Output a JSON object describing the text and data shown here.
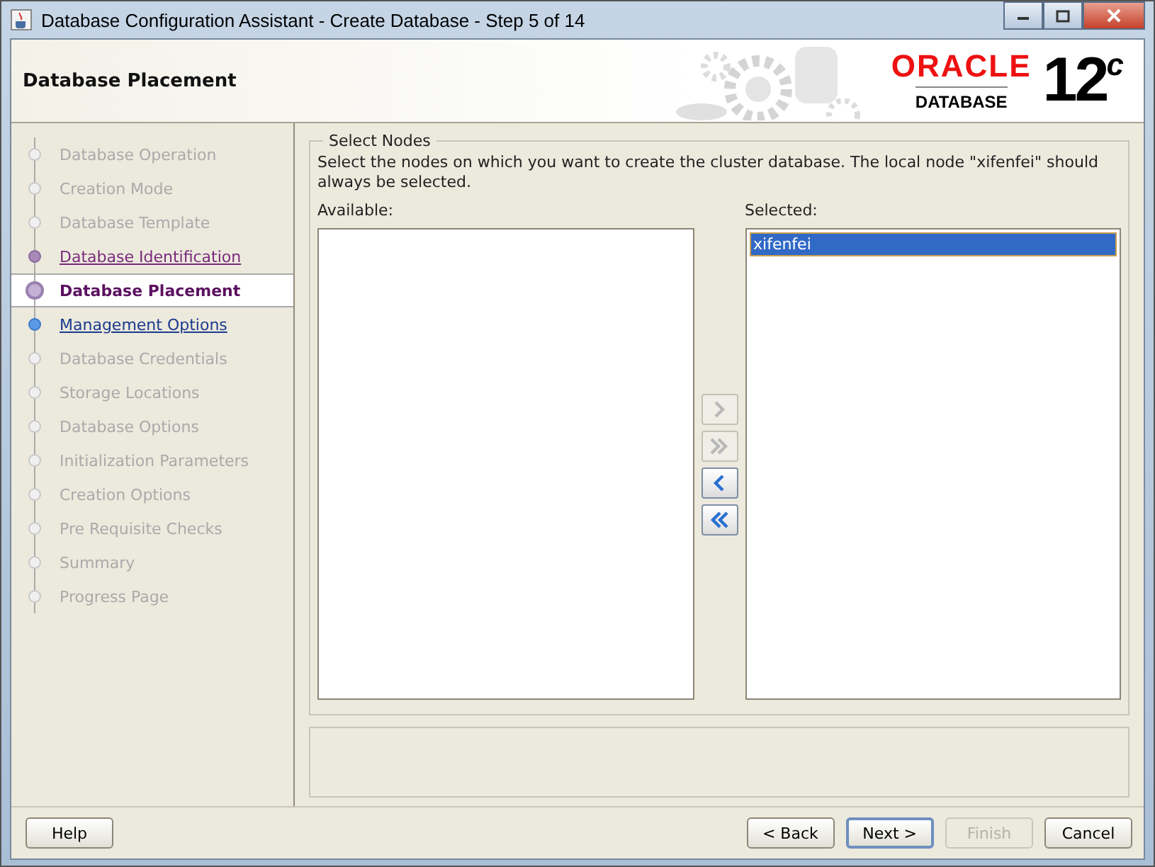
{
  "window": {
    "title": "Database Configuration Assistant - Create Database - Step 5 of 14"
  },
  "header": {
    "title": "Database Placement",
    "logo_brand": "ORACLE",
    "logo_product": "DATABASE",
    "logo_version": "12",
    "logo_suffix": "c"
  },
  "steps": [
    {
      "label": "Database Operation",
      "selected": false,
      "completed": false,
      "disabled": true
    },
    {
      "label": "Creation Mode",
      "selected": false,
      "completed": false,
      "disabled": true
    },
    {
      "label": "Database Template",
      "selected": false,
      "completed": false,
      "disabled": true
    },
    {
      "label": "Database Identification",
      "selected": false,
      "completed": true,
      "disabled": false
    },
    {
      "label": "Database Placement",
      "selected": true,
      "completed": false,
      "disabled": false
    },
    {
      "label": "Management Options",
      "selected": false,
      "completed": false,
      "disabled": false
    },
    {
      "label": "Database Credentials",
      "selected": false,
      "completed": false,
      "disabled": true
    },
    {
      "label": "Storage Locations",
      "selected": false,
      "completed": false,
      "disabled": true
    },
    {
      "label": "Database Options",
      "selected": false,
      "completed": false,
      "disabled": true
    },
    {
      "label": "Initialization Parameters",
      "selected": false,
      "completed": false,
      "disabled": true
    },
    {
      "label": "Creation Options",
      "selected": false,
      "completed": false,
      "disabled": true
    },
    {
      "label": "Pre Requisite Checks",
      "selected": false,
      "completed": false,
      "disabled": true
    },
    {
      "label": "Summary",
      "selected": false,
      "completed": false,
      "disabled": true
    },
    {
      "label": "Progress Page",
      "selected": false,
      "completed": false,
      "disabled": true
    }
  ],
  "select_nodes": {
    "legend": "Select Nodes",
    "description": "Select the nodes on which you want to create the cluster database. The local node \"xifenfei\" should always be selected.",
    "available": {
      "label": "Available:"
    },
    "selected": {
      "label": "Selected:",
      "items": [
        {
          "text": "xifenfei",
          "selected": true
        }
      ]
    },
    "transfer_buttons": [
      {
        "kind": "add",
        "disabled": true
      },
      {
        "kind": "add_all",
        "disabled": true
      },
      {
        "kind": "remove",
        "disabled": false
      },
      {
        "kind": "remove_all",
        "disabled": false
      }
    ]
  },
  "buttons": [
    {
      "label": "Help",
      "disabled": false,
      "default": false
    },
    {
      "label": "< Back",
      "disabled": false,
      "default": false
    },
    {
      "label": "Next >",
      "disabled": false,
      "default": true
    },
    {
      "label": "Finish",
      "disabled": true,
      "default": false
    },
    {
      "label": "Cancel",
      "disabled": false,
      "default": false
    }
  ]
}
